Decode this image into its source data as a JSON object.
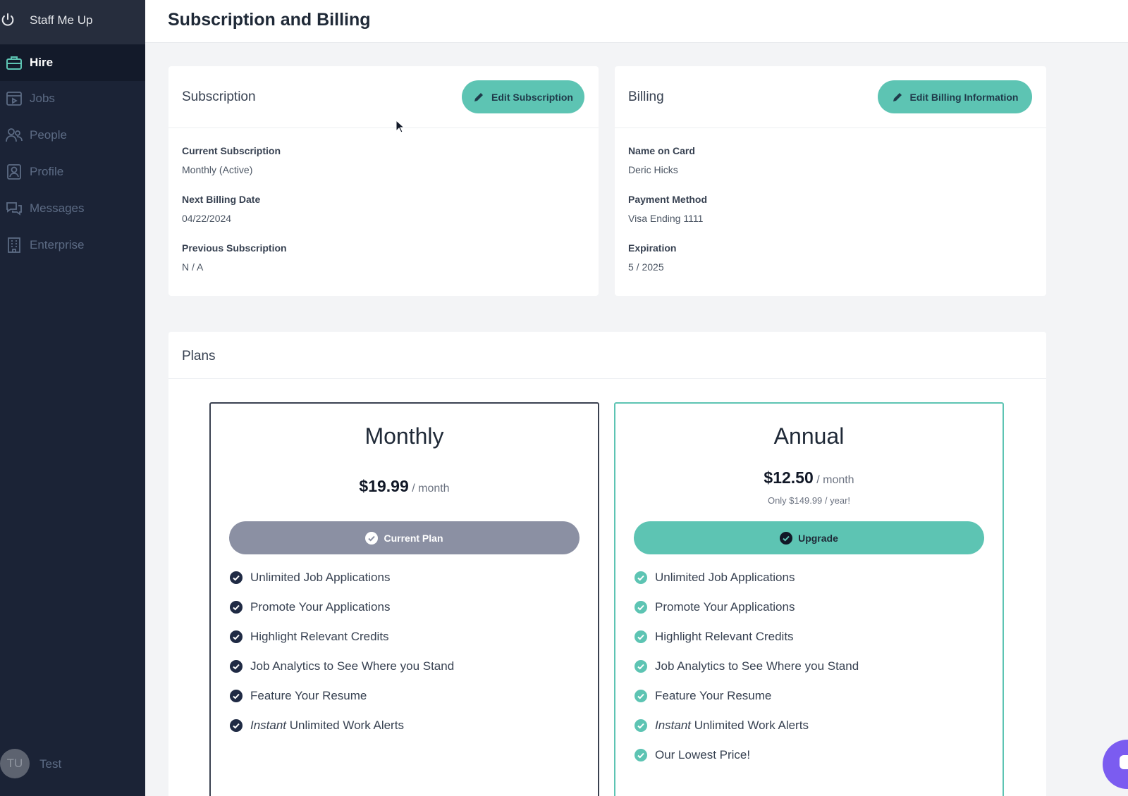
{
  "app": {
    "name": "Staff Me Up"
  },
  "sidebar": {
    "items": [
      {
        "label": "Hire",
        "icon": "briefcase-icon",
        "active": true
      },
      {
        "label": "Jobs",
        "icon": "jobs-icon",
        "active": false
      },
      {
        "label": "People",
        "icon": "people-icon",
        "active": false
      },
      {
        "label": "Profile",
        "icon": "profile-icon",
        "active": false
      },
      {
        "label": "Messages",
        "icon": "messages-icon",
        "active": false
      },
      {
        "label": "Enterprise",
        "icon": "building-icon",
        "active": false
      }
    ],
    "user": {
      "initials": "TU",
      "name": "Test"
    }
  },
  "header": {
    "title": "Subscription and Billing"
  },
  "subscription": {
    "title": "Subscription",
    "edit_label": "Edit Subscription",
    "fields": [
      {
        "label": "Current Subscription",
        "value": "Monthly (Active)"
      },
      {
        "label": "Next Billing Date",
        "value": "04/22/2024"
      },
      {
        "label": "Previous Subscription",
        "value": "N / A"
      }
    ]
  },
  "billing": {
    "title": "Billing",
    "edit_label": "Edit Billing Information",
    "fields": [
      {
        "label": "Name on Card",
        "value": "Deric Hicks"
      },
      {
        "label": "Payment Method",
        "value": "Visa Ending 1111"
      },
      {
        "label": "Expiration",
        "value": "5 / 2025"
      }
    ]
  },
  "plans": {
    "title": "Plans",
    "monthly": {
      "name": "Monthly",
      "price": "$19.99",
      "per": "/ month",
      "button_label": "Current Plan",
      "features": [
        "Unlimited Job Applications",
        "Promote Your Applications",
        "Highlight Relevant Credits",
        "Job Analytics to See Where you Stand",
        "Feature Your Resume"
      ],
      "alert_em": "Instant",
      "alert_rest": " Unlimited Work Alerts"
    },
    "annual": {
      "name": "Annual",
      "price": "$12.50",
      "per": "/ month",
      "yearly_note": "Only $149.99 / year!",
      "button_label": "Upgrade",
      "features": [
        "Unlimited Job Applications",
        "Promote Your Applications",
        "Highlight Relevant Credits",
        "Job Analytics to See Where you Stand",
        "Feature Your Resume"
      ],
      "alert_em": "Instant",
      "alert_rest": " Unlimited Work Alerts",
      "extra_feature": "Our Lowest Price!"
    }
  },
  "colors": {
    "sidebar_bg": "#1b2336",
    "accent": "#5dc4b3",
    "current_plan_btn": "#8b90a3",
    "chat_bubble": "#7b5cf0"
  }
}
